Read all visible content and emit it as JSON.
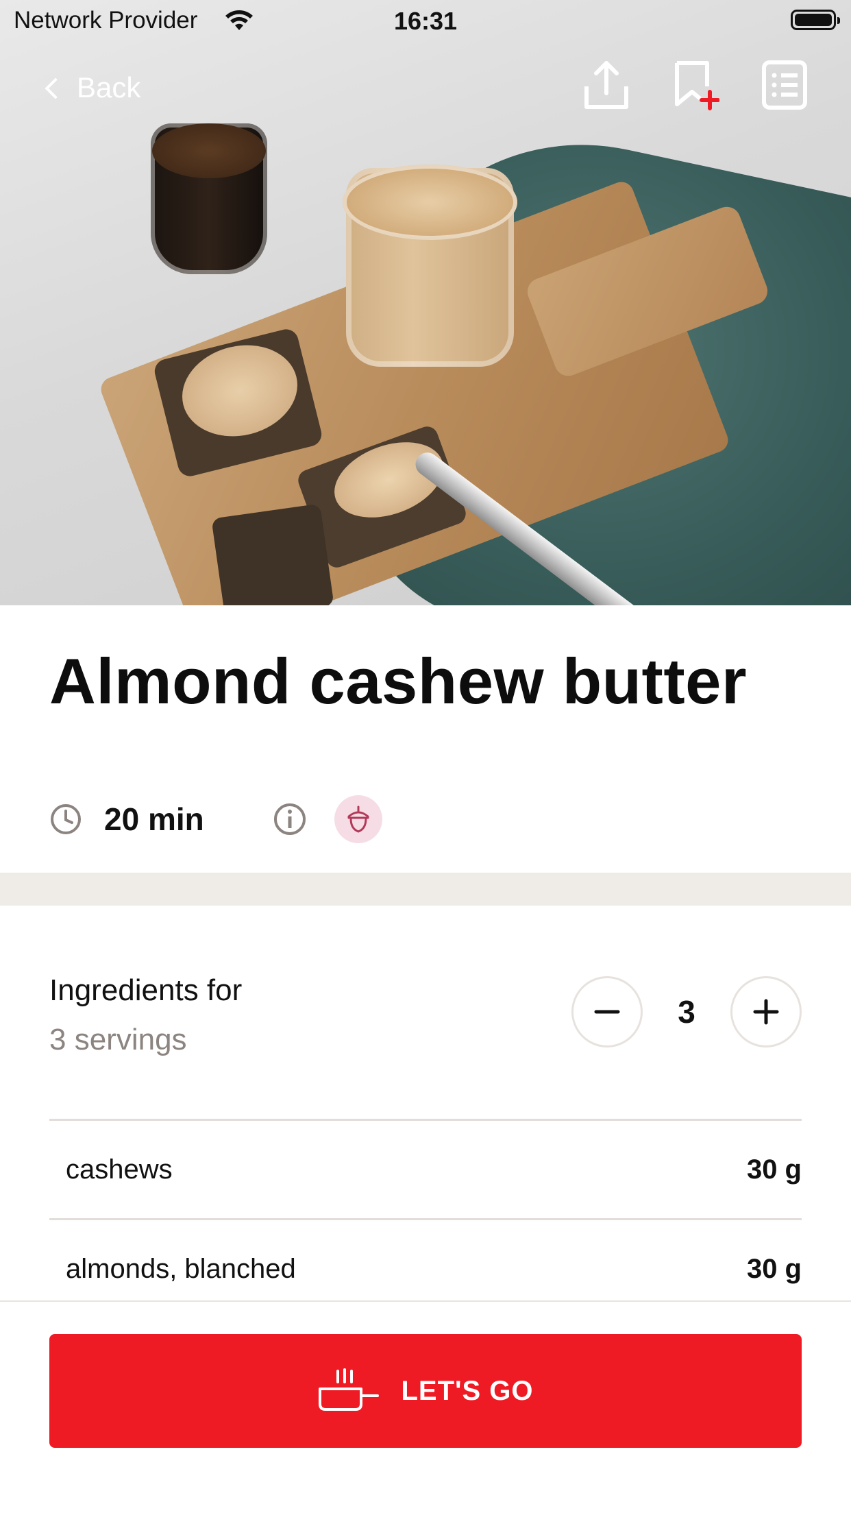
{
  "status_bar": {
    "carrier": "Network Provider",
    "time": "16:31"
  },
  "nav": {
    "back_label": "Back"
  },
  "recipe": {
    "title": "Almond cashew butter",
    "time": "20 min"
  },
  "ingredients": {
    "heading": "Ingredients for",
    "servings_label": "3 servings",
    "servings_value": "3",
    "items": [
      {
        "name": "cashews",
        "qty": "30 g"
      },
      {
        "name": "almonds, blanched",
        "qty": "30 g"
      }
    ]
  },
  "cta": {
    "label": "LET'S GO"
  },
  "colors": {
    "accent": "#ee1b25",
    "band": "#efebe7",
    "nut_badge": "#f6dde5"
  }
}
